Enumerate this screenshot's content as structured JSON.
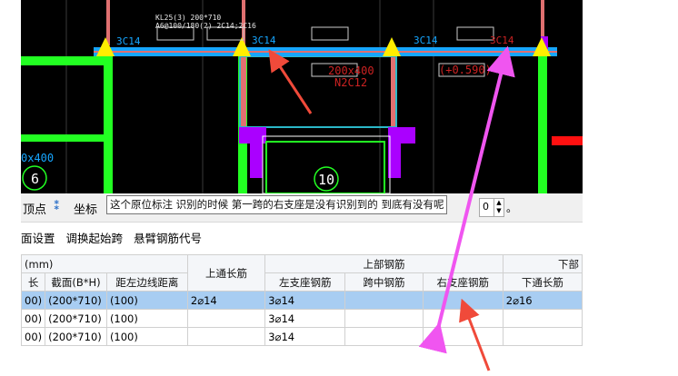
{
  "cad": {
    "beam_label": "KL25(3) 200*710",
    "beam_spec": "A6@100/180(2) 2C14;2C16",
    "top_bar_labels": [
      "3C14",
      "3C14",
      "3C14",
      "3C14"
    ],
    "secondary_section": "200x400",
    "secondary_bars": "N2C12",
    "offset_label": "(+0.590)",
    "axis_number": "10",
    "left_section": "0x400",
    "left_number": "6",
    "colors": {
      "cyan": "#16a6ff",
      "green": "#22ff22",
      "magenta": "#aa00ff",
      "yellow": "#ffee00",
      "red": "#ff1010",
      "pink": "#e07070"
    }
  },
  "toolbar": {
    "item1": "顶点",
    "item2": "坐标",
    "tooltip": "这个原位标注 识别的时候 第一跨的右支座是没有识别到的  到底有没有呢",
    "value1": "0",
    "value_suffix": "。"
  },
  "toolbar2": {
    "items": [
      "面设置",
      "调换起始跨",
      "悬臂钢筋代号"
    ]
  },
  "grid": {
    "unit": "(mm)",
    "top_group": "上部钢筋",
    "bottom_group": "下部",
    "headers": {
      "len": "长",
      "section": "截面(B*H)",
      "offset": "距左边线距离",
      "top_through": "上通长筋",
      "left_support": "左支座钢筋",
      "mid_span": "跨中钢筋",
      "right_support": "右支座钢筋",
      "bottom_through": "下通长筋"
    },
    "rows": [
      {
        "len": "00)",
        "section": "(200*710)",
        "offset": "(100)",
        "top_through": "2⌀14",
        "left_support": "3⌀14",
        "mid_span": "",
        "right_support": "",
        "bottom_through": "2⌀16"
      },
      {
        "len": "00)",
        "section": "(200*710)",
        "offset": "(100)",
        "top_through": "",
        "left_support": "3⌀14",
        "mid_span": "",
        "right_support": "",
        "bottom_through": ""
      },
      {
        "len": "00)",
        "section": "(200*710)",
        "offset": "(100)",
        "top_through": "",
        "left_support": "3⌀14",
        "mid_span": "",
        "right_support": "",
        "bottom_through": ""
      }
    ]
  },
  "annotations": {
    "arrow_color": "#f055f0",
    "red_arrow_color": "#f04a3a"
  }
}
